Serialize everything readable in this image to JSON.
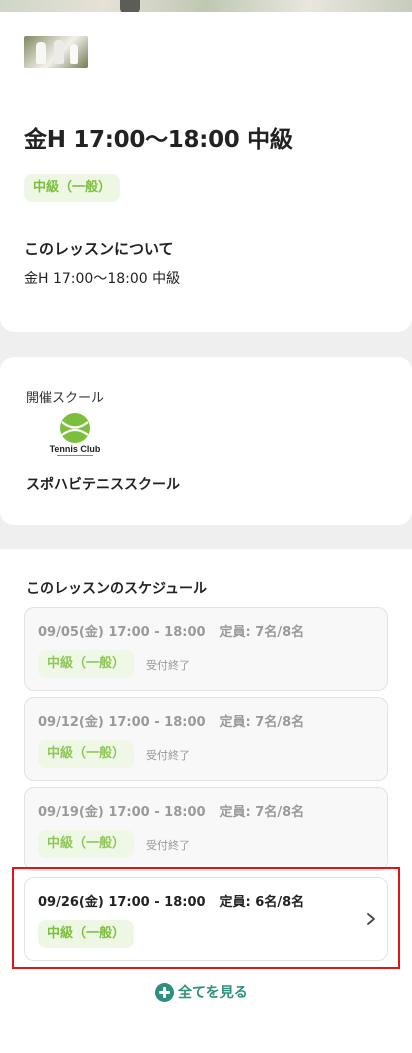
{
  "lesson": {
    "title": "金H 17:00〜18:00 中級",
    "level": "中級（一般）",
    "about_heading": "このレッスンについて",
    "about_text": "金H 17:00〜18:00 中級"
  },
  "host": {
    "label": "開催スクール",
    "logo_text": "Tennis Club",
    "school_name": "スポハビテニススクール"
  },
  "schedule": {
    "heading": "このレッスンのスケジュール",
    "items": [
      {
        "datetime": "09/05(金) 17:00 - 18:00",
        "capacity": "定員: 7名/8名",
        "level": "中級（一般）",
        "status": "受付終了"
      },
      {
        "datetime": "09/12(金) 17:00 - 18:00",
        "capacity": "定員: 7名/8名",
        "level": "中級（一般）",
        "status": "受付終了"
      },
      {
        "datetime": "09/19(金) 17:00 - 18:00",
        "capacity": "定員: 7名/8名",
        "level": "中級（一般）",
        "status": "受付終了"
      },
      {
        "datetime": "09/26(金) 17:00 - 18:00",
        "capacity": "定員: 6名/8名",
        "level": "中級（一般）",
        "status": ""
      }
    ],
    "see_all": "全てを見る"
  },
  "colors": {
    "accent_green": "#7cbf3c",
    "tag_bg": "#eef7e3",
    "teal": "#2f8f7e",
    "highlight": "#e01515"
  }
}
